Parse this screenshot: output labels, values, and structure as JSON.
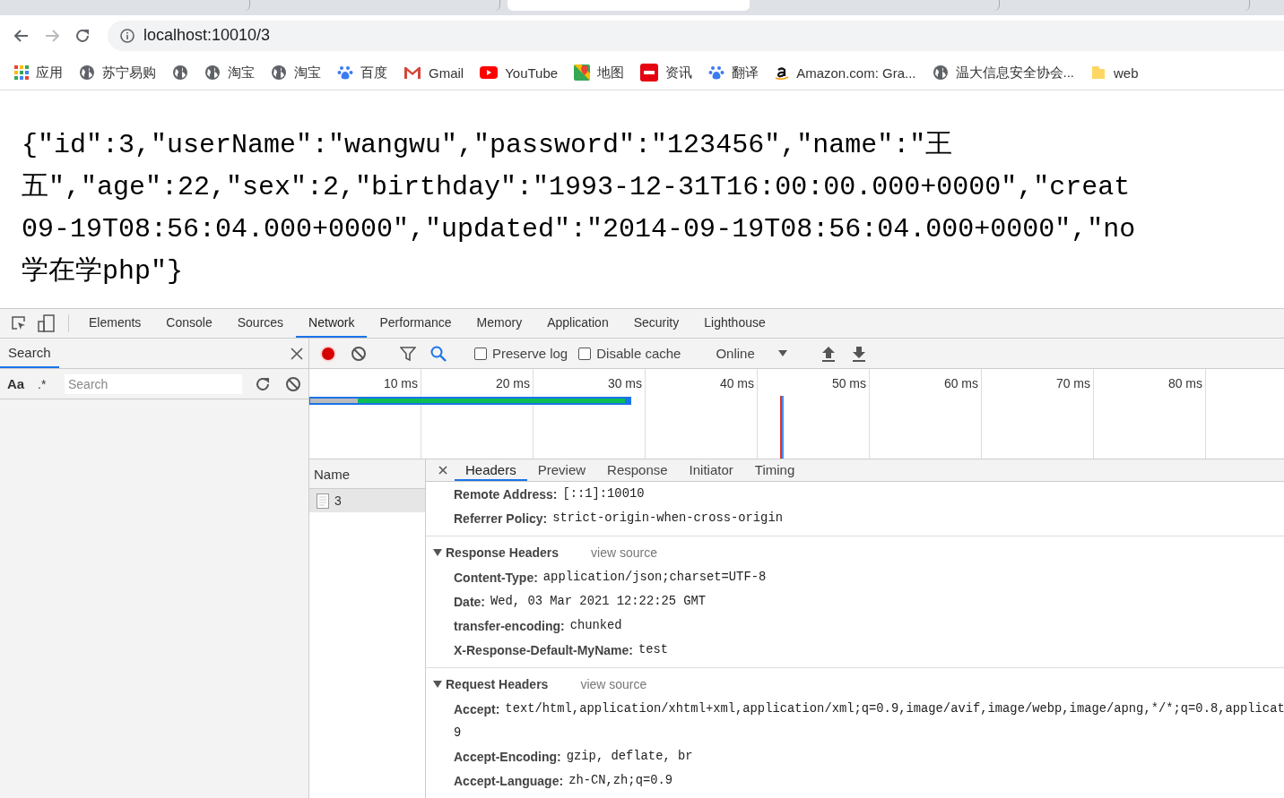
{
  "browser": {
    "tabs": [
      {
        "selected": false
      },
      {
        "selected": false
      },
      {
        "selected": true
      },
      {
        "selected": false
      },
      {
        "selected": false
      }
    ],
    "back_disabled": false,
    "forward_disabled": true,
    "url": "localhost:10010/3",
    "bookmarks": [
      {
        "kind": "apps",
        "label": "应用"
      },
      {
        "kind": "globe",
        "label": "苏宁易购"
      },
      {
        "kind": "globe"
      },
      {
        "kind": "globe",
        "label": "淘宝"
      },
      {
        "kind": "globe",
        "label": "淘宝"
      },
      {
        "kind": "paw",
        "label": "百度"
      },
      {
        "kind": "mail",
        "label": "Gmail"
      },
      {
        "kind": "video",
        "label": "YouTube"
      },
      {
        "kind": "map",
        "label": "地图"
      },
      {
        "kind": "news",
        "label": "资讯"
      },
      {
        "kind": "paw",
        "label": "翻译"
      },
      {
        "kind": "amazon",
        "label": "Amazon.com: Gra..."
      },
      {
        "kind": "globe",
        "label": "温大信息安全协会..."
      },
      {
        "kind": "folder",
        "label": "web"
      }
    ]
  },
  "page": {
    "lines": [
      "{\"id\":3,\"userName\":\"wangwu\",\"password\":\"123456\",\"name\":\"王",
      "五\",\"age\":22,\"sex\":2,\"birthday\":\"1993-12-31T16:00:00.000+0000\",\"creat",
      "09-19T08:56:04.000+0000\",\"updated\":\"2014-09-19T08:56:04.000+0000\",\"no",
      "学在学php\"}"
    ]
  },
  "devtools": {
    "tabs": [
      {
        "label": "Elements",
        "selected": false
      },
      {
        "label": "Console",
        "selected": false
      },
      {
        "label": "Sources",
        "selected": false
      },
      {
        "label": "Network",
        "selected": true
      },
      {
        "label": "Performance",
        "selected": false
      },
      {
        "label": "Memory",
        "selected": false
      },
      {
        "label": "Application",
        "selected": false
      },
      {
        "label": "Security",
        "selected": false
      },
      {
        "label": "Lighthouse",
        "selected": false
      }
    ],
    "search_panel": {
      "title": "Search",
      "case_label": "Aa",
      "regex_label": ".*",
      "placeholder": "Search"
    },
    "toolbar": {
      "recording": true,
      "search_selected": true,
      "preserve_log": {
        "label": "Preserve log",
        "checked": false
      },
      "disable_cache": {
        "label": "Disable cache",
        "checked": false
      },
      "throttling": "Online"
    },
    "overview": {
      "ticks": [
        "10 ms",
        "20 ms",
        "30 ms",
        "40 ms",
        "50 ms",
        "60 ms",
        "70 ms",
        "80 ms"
      ]
    },
    "requests": {
      "column": "Name",
      "rows": [
        {
          "name": "3",
          "selected": true
        }
      ]
    },
    "details": {
      "tabs": [
        {
          "label": "Headers",
          "selected": true
        },
        {
          "label": "Preview",
          "selected": false
        },
        {
          "label": "Response",
          "selected": false
        },
        {
          "label": "Initiator",
          "selected": false
        },
        {
          "label": "Timing",
          "selected": false
        }
      ],
      "general": [
        {
          "key": "Remote Address:",
          "value": "[::1]:10010"
        },
        {
          "key": "Referrer Policy:",
          "value": "strict-origin-when-cross-origin"
        }
      ],
      "sections": [
        {
          "title": "Response Headers",
          "expanded": true,
          "link": "view source",
          "headers": [
            {
              "key": "Content-Type:",
              "value": "application/json;charset=UTF-8"
            },
            {
              "key": "Date:",
              "value": "Wed, 03 Mar 2021 12:22:25 GMT"
            },
            {
              "key": "transfer-encoding:",
              "value": "chunked"
            },
            {
              "key": "X-Response-Default-MyName:",
              "value": "test"
            }
          ]
        },
        {
          "title": "Request Headers",
          "expanded": true,
          "link": "view source",
          "headers": [
            {
              "key": "Accept:",
              "value": "text/html,application/xhtml+xml,application/xml;q=0.9,image/avif,image/webp,image/apng,*/*;q=0.8,applicat",
              "continuation": "9"
            },
            {
              "key": "Accept-Encoding:",
              "value": "gzip, deflate, br"
            },
            {
              "key": "Accept-Language:",
              "value": "zh-CN,zh;q=0.9"
            }
          ]
        }
      ]
    }
  }
}
